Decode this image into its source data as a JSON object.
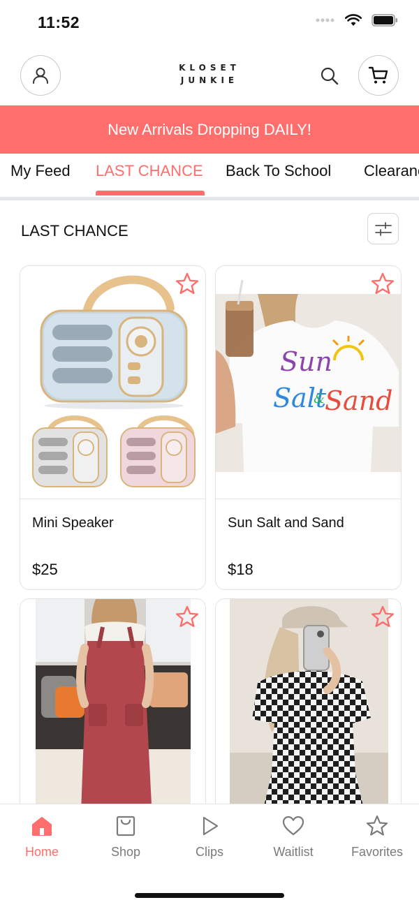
{
  "status_bar": {
    "time": "11:52"
  },
  "header": {
    "logo_line1": "KLOSET",
    "logo_line2": "JUNKIE",
    "profile_icon": "person-icon",
    "search_icon": "search-icon",
    "cart_icon": "cart-icon"
  },
  "banner": {
    "text": "New Arrivals Dropping DAILY!"
  },
  "tabs": [
    {
      "label": "My Feed",
      "active": false
    },
    {
      "label": "LAST CHANCE",
      "active": true
    },
    {
      "label": "Back To School",
      "active": false
    },
    {
      "label": "Clearance",
      "active": false
    }
  ],
  "section": {
    "title": "LAST CHANCE",
    "filter_icon": "sliders-icon"
  },
  "products": [
    {
      "name": "Mini Speaker",
      "price": "$25",
      "image": "speaker-photo"
    },
    {
      "name": "Sun Salt and Sand",
      "price": "$18",
      "image": "tshirt-photo"
    },
    {
      "name": "",
      "price": "",
      "image": "jumpsuit-photo"
    },
    {
      "name": "",
      "price": "",
      "image": "checkered-set-photo"
    }
  ],
  "bottom_nav": [
    {
      "label": "Home",
      "icon": "home-icon",
      "active": true
    },
    {
      "label": "Shop",
      "icon": "shopping-bag-icon",
      "active": false
    },
    {
      "label": "Clips",
      "icon": "play-icon",
      "active": false
    },
    {
      "label": "Waitlist",
      "icon": "heart-icon",
      "active": false
    },
    {
      "label": "Favorites",
      "icon": "star-icon",
      "active": false
    }
  ],
  "colors": {
    "accent": "#fd6e6d",
    "divider": "#e3e6ea",
    "text": "#111111",
    "muted": "#7a7a7a"
  }
}
